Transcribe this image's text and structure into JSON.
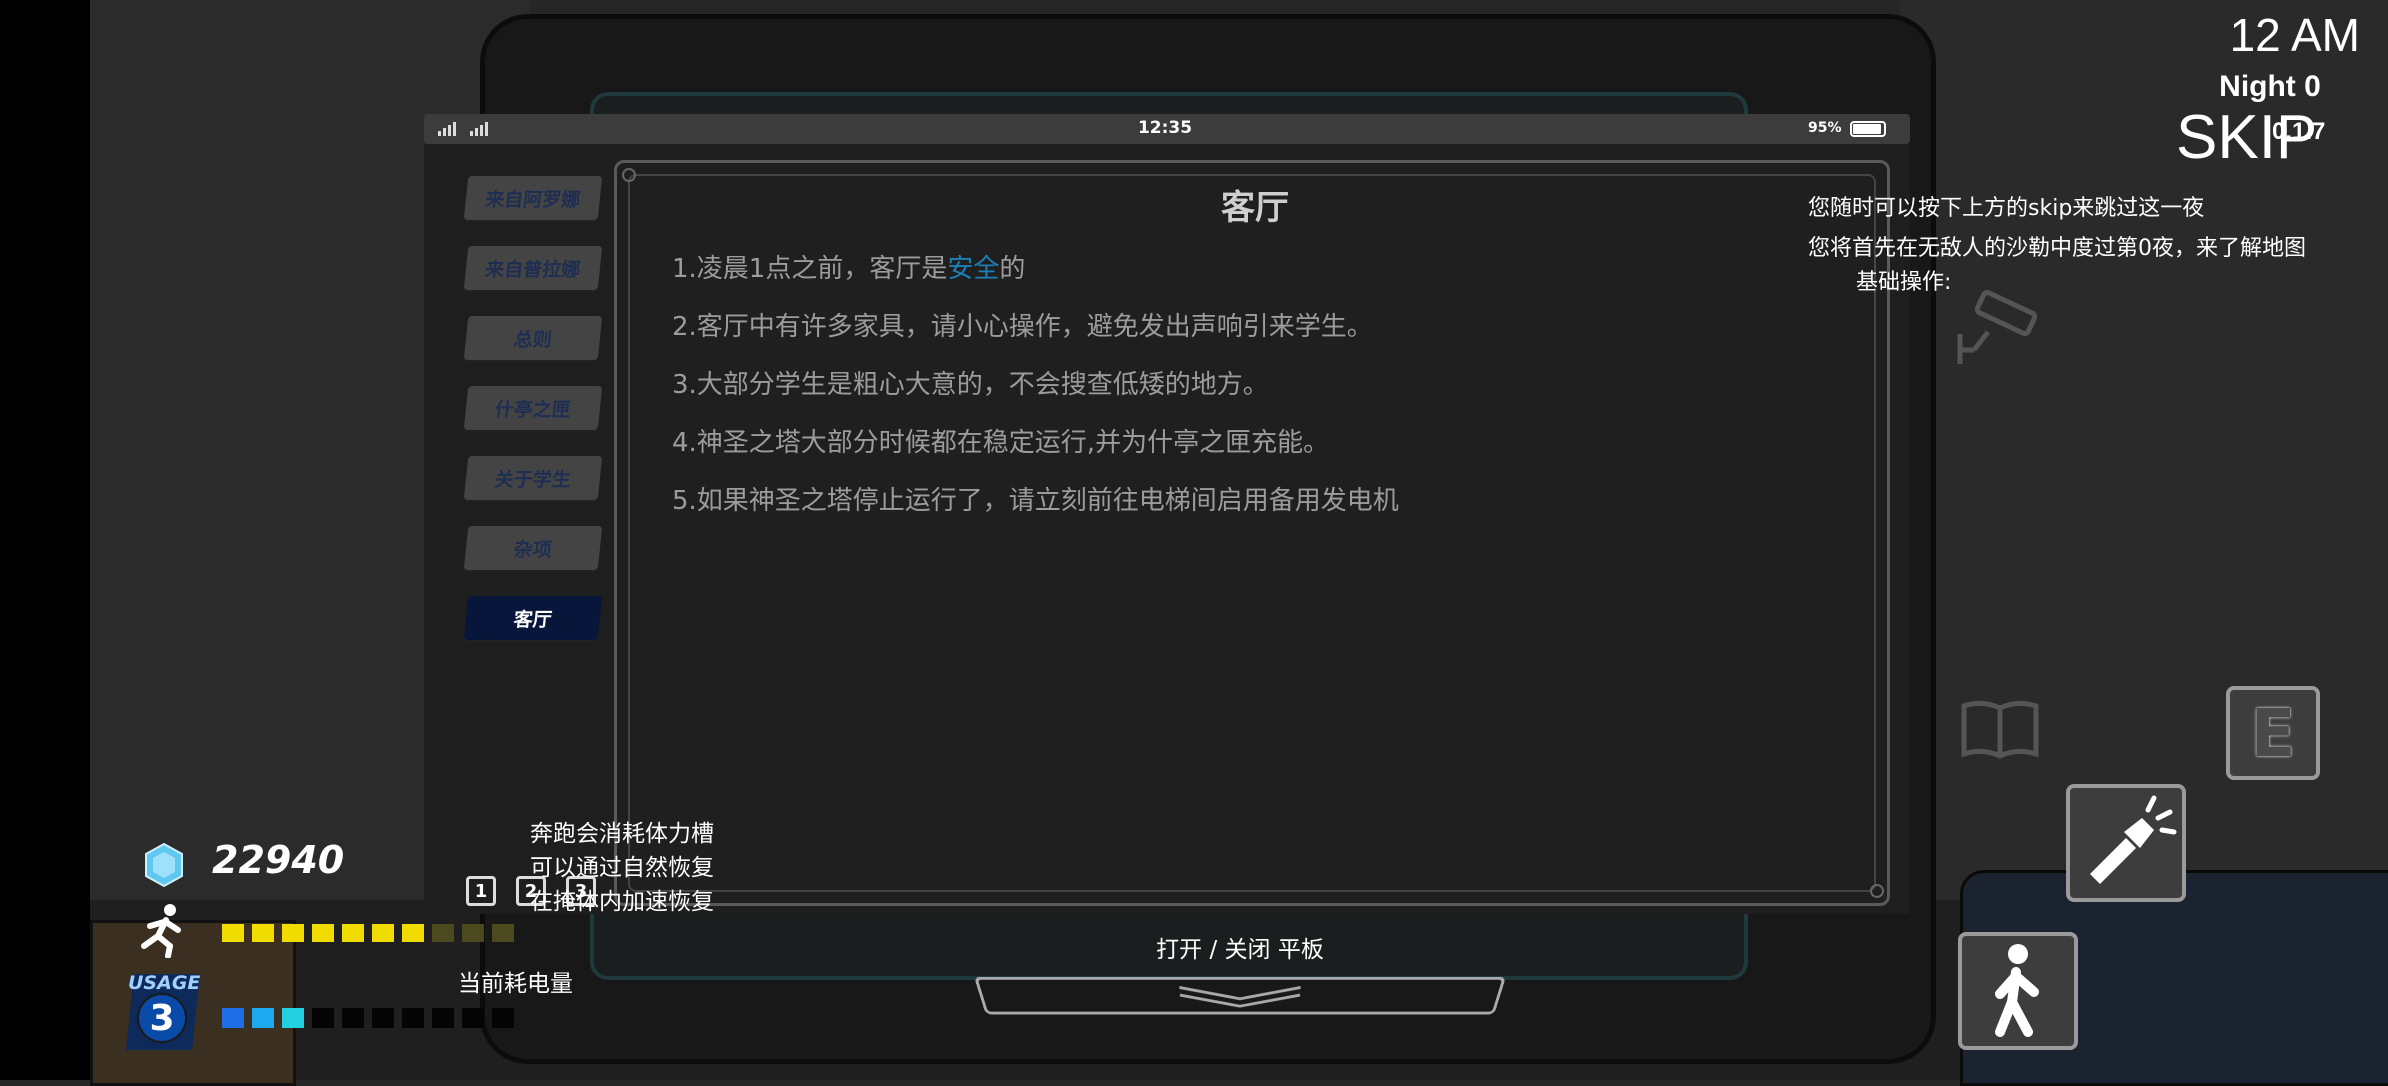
{
  "hud": {
    "time": "12  AM",
    "night": "Night 0",
    "skip": "SKIP",
    "version": "0.1.7",
    "hint_skip": "您随时可以按下上方的skip来跳过这一夜",
    "hint_intro": "您将首先在无敌人的沙勒中度过第0夜，来了解地图",
    "hint_basics": "基础操作:"
  },
  "tablet": {
    "status_time": "12:35",
    "battery": "95%",
    "sidebar": [
      {
        "label": "来自阿罗娜"
      },
      {
        "label": "来自普拉娜"
      },
      {
        "label": "总则"
      },
      {
        "label": "什亭之匣"
      },
      {
        "label": "关于学生"
      },
      {
        "label": "杂项"
      },
      {
        "label": "客厅"
      }
    ],
    "content": {
      "title": "客厅",
      "rule1_pre": "1.凌晨1点之前，客厅是",
      "rule1_safe": "安全",
      "rule1_post": "的",
      "rule2": "2.客厅中有许多家具，请小心操作，避免发出声响引来学生。",
      "rule3": "3.大部分学生是粗心大意的，不会搜查低矮的地方。",
      "rule4": "4.神圣之塔大部分时候都在稳定运行,并为什亭之匣充能。",
      "rule5": "5.如果神圣之塔停止运行了，请立刻前往电梯间启用备用发电机"
    },
    "toggle_label": "打开 / 关闭 平板"
  },
  "player": {
    "gems": "22940",
    "stamina_filled": 7,
    "stamina_total": 10,
    "usage_label": "USAGE",
    "usage_value": "3",
    "power_filled": 3,
    "power_total": 10,
    "power_label": "当前耗电量",
    "slots": [
      "1",
      "2",
      "3"
    ],
    "tip_line1": "奔跑会消耗体力槽",
    "tip_line2": "可以通过自然恢复",
    "tip_line3": "在掩体内加速恢复"
  },
  "colors": {
    "stamina_on": "#f0dc00",
    "stamina_off": "#4a4a1e",
    "power_on_1": "#1e6ee6",
    "power_on_2": "#1ea8f0",
    "power_on_3": "#22d0e0",
    "power_off": "#050505",
    "safe_text": "#1d7fb8",
    "active_tab": "#07163a"
  },
  "icons": {
    "camera": "security-camera-icon",
    "book": "book-icon",
    "interact": "e-key-icon",
    "flashlight": "flashlight-icon",
    "walk": "walk-icon",
    "gem": "gem-icon",
    "run": "run-icon"
  }
}
